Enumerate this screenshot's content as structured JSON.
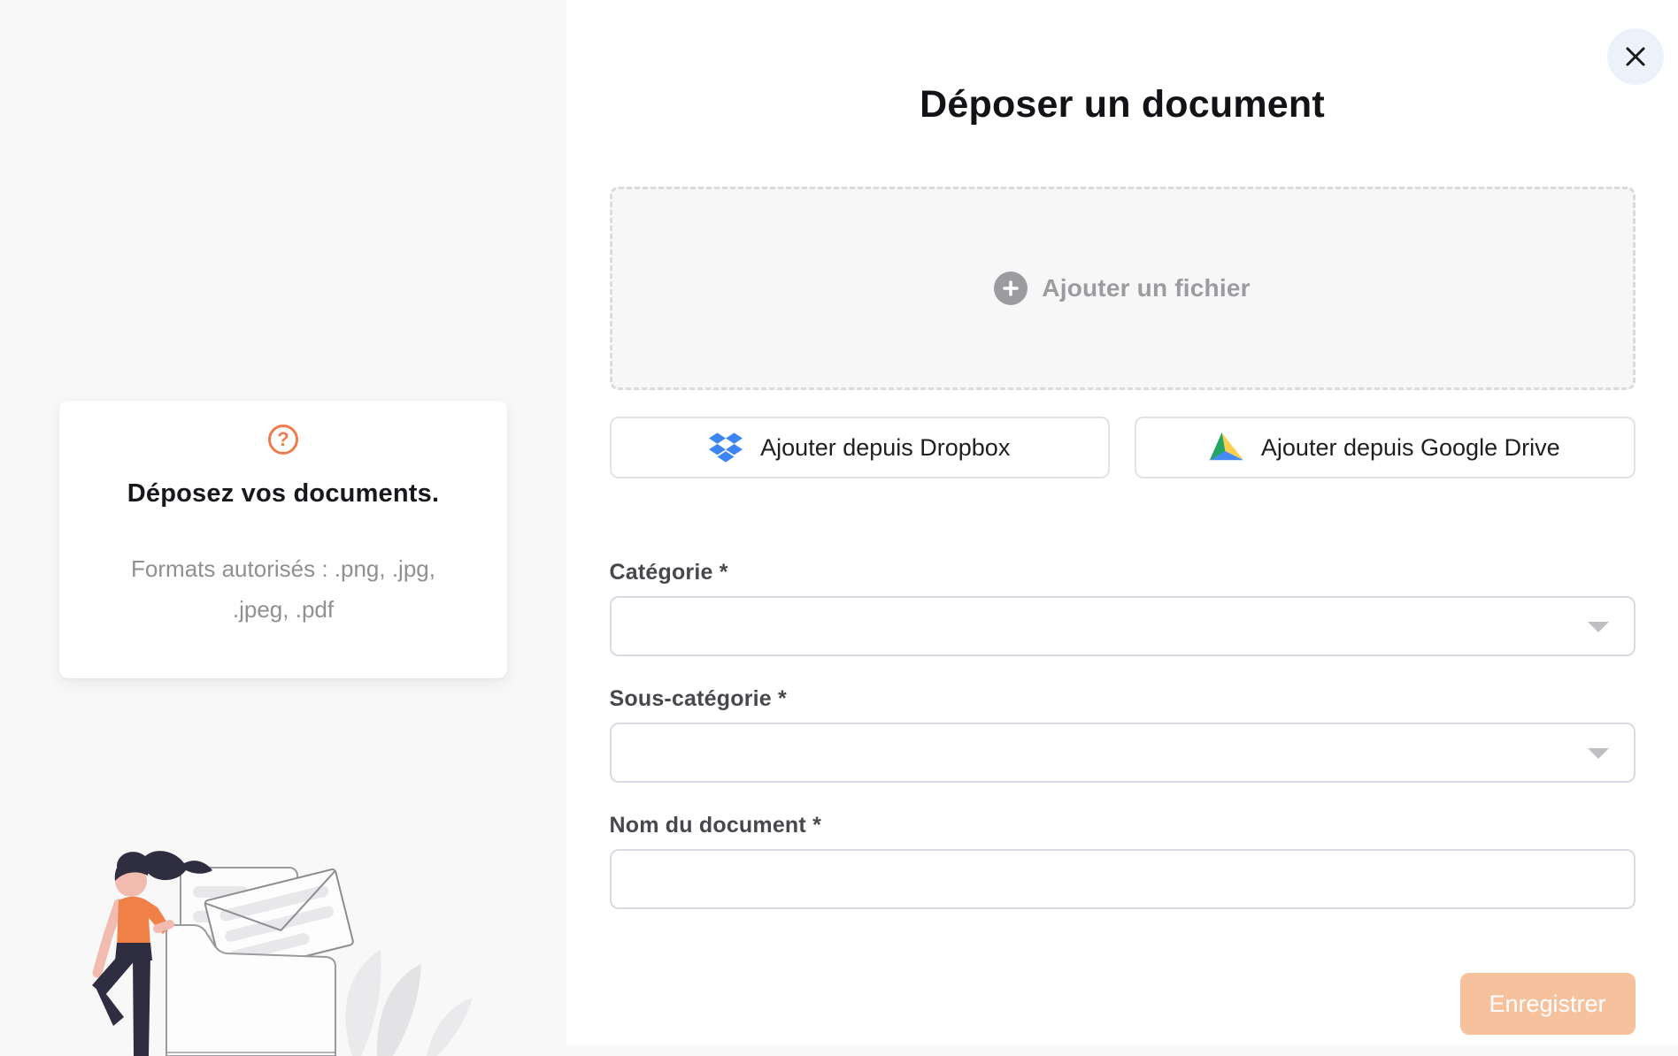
{
  "modal": {
    "title": "Déposer un document"
  },
  "dropzone": {
    "add_file_label": "Ajouter un fichier"
  },
  "import_buttons": [
    {
      "label": "Ajouter depuis Dropbox"
    },
    {
      "label": "Ajouter depuis Google Drive"
    }
  ],
  "form": {
    "fields": [
      {
        "label": "Catégorie *",
        "type": "select",
        "value": ""
      },
      {
        "label": "Sous-catégorie *",
        "type": "select",
        "value": ""
      },
      {
        "label": "Nom du document *",
        "type": "text",
        "value": ""
      }
    ],
    "submit_label": "Enregistrer"
  },
  "sidebar": {
    "card": {
      "help_glyph": "?",
      "title": "Déposez vos documents.",
      "subtitle": "Formats autorisés : .png, .jpg, .jpeg, .pdf"
    }
  },
  "colors": {
    "accent_orange": "#ED7B4E",
    "save_button_bg": "#F6C19D",
    "close_button_bg": "#ECF1FB",
    "left_panel_bg": "#F8F8F8",
    "dropbox_blue": "#3D84F5",
    "drive_green": "#23A566",
    "drive_yellow": "#FFCF4F",
    "drive_blue": "#4688F4"
  }
}
